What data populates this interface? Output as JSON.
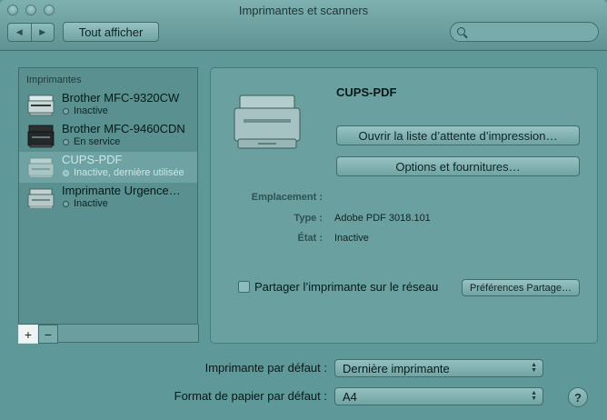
{
  "window": {
    "title": "Imprimantes et scanners"
  },
  "toolbar": {
    "back_icon": "◀",
    "forward_icon": "▶",
    "show_all_label": "Tout afficher",
    "search_placeholder": ""
  },
  "printers": {
    "header": "Imprimantes",
    "items": [
      {
        "name": "Brother MFC-9320CW",
        "status": "Inactive",
        "selected": false
      },
      {
        "name": "Brother MFC-9460CDN",
        "status": "En service",
        "selected": false
      },
      {
        "name": "CUPS-PDF",
        "status": "Inactive, dernière utilisée",
        "selected": true
      },
      {
        "name": "Imprimante Urgence…",
        "status": "Inactive",
        "selected": false
      }
    ],
    "add_label": "+",
    "remove_label": "−"
  },
  "detail": {
    "name": "CUPS-PDF",
    "queue_button": "Ouvrir la liste d’attente d’impression…",
    "options_button": "Options et fournitures…",
    "location_label": "Emplacement :",
    "location_value": "",
    "type_label": "Type :",
    "type_value": "Adobe PDF 3018.101",
    "state_label": "État :",
    "state_value": "Inactive",
    "share_label": "Partager l’imprimante sur le réseau",
    "share_checked": false,
    "share_prefs_button": "Préférences Partage…"
  },
  "defaults": {
    "printer_label": "Imprimante par défaut :",
    "printer_value": "Dernière imprimante",
    "paper_label": "Format de papier par défaut :",
    "paper_value": "A4"
  },
  "help": {
    "label": "?"
  },
  "colors": {
    "tint": "#5f9898",
    "selection": "#6fa3a3"
  }
}
